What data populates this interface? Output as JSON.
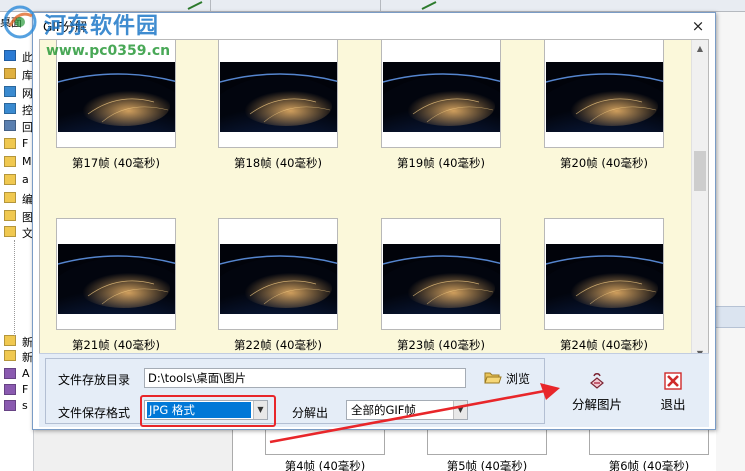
{
  "background": {
    "left_panel": {
      "title": "桌面",
      "items": [
        {
          "label": "此",
          "icon": "monitor-icon",
          "color": "#2b7bd4"
        },
        {
          "label": "库",
          "icon": "library-icon",
          "color": "#e0b040"
        },
        {
          "label": "网",
          "icon": "network-icon",
          "color": "#3a8ad0"
        },
        {
          "label": "控",
          "icon": "control-panel-icon",
          "color": "#3a8ad0"
        },
        {
          "label": "回",
          "icon": "recycle-bin-icon",
          "color": "#5a7fb0"
        },
        {
          "label": "F",
          "icon": "folder-icon",
          "color": "#f0c850"
        },
        {
          "label": "M",
          "icon": "folder-icon",
          "color": "#f0c850"
        },
        {
          "label": "a",
          "icon": "folder-icon",
          "color": "#f0c850"
        },
        {
          "label": "编",
          "icon": "folder-icon",
          "color": "#f0c850"
        },
        {
          "label": "图",
          "icon": "folder-icon",
          "color": "#f0c850"
        },
        {
          "label": "文",
          "icon": "folder-icon",
          "color": "#f0c850"
        }
      ],
      "bottom_items": [
        {
          "label": "新",
          "icon": "folder-icon",
          "color": "#f0c850"
        },
        {
          "label": "新",
          "icon": "folder-icon",
          "color": "#f0c850"
        },
        {
          "label": "A",
          "icon": "archive-icon",
          "color": "#8a5ab0"
        },
        {
          "label": "F",
          "icon": "archive-icon",
          "color": "#8a5ab0"
        },
        {
          "label": "s",
          "icon": "archive-icon",
          "color": "#8a5ab0"
        }
      ]
    },
    "bottom_frames": [
      {
        "caption": "第4帧 (40毫秒)"
      },
      {
        "caption": "第5帧 (40毫秒)"
      },
      {
        "caption": "第6帧 (40毫秒)"
      }
    ]
  },
  "watermark": {
    "name": "河东软件园",
    "url": "www.pc0359.cn"
  },
  "dialog": {
    "title": "GIF分解",
    "close_icon": "×",
    "frames": [
      {
        "caption": "第17帧 (40毫秒)"
      },
      {
        "caption": "第18帧 (40毫秒)"
      },
      {
        "caption": "第19帧 (40毫秒)"
      },
      {
        "caption": "第20帧 (40毫秒)"
      },
      {
        "caption": "第21帧 (40毫秒)"
      },
      {
        "caption": "第22帧 (40毫秒)"
      },
      {
        "caption": "第23帧 (40毫秒)"
      },
      {
        "caption": "第24帧 (40毫秒)"
      }
    ],
    "scroll_position": 0.38,
    "form": {
      "dir_label": "文件存放目录",
      "dir_value": "D:\\tools\\桌面\\图片",
      "browse_label": "浏览",
      "format_label": "文件保存格式",
      "format_value": "JPG 格式",
      "split_label": "分解出",
      "split_value": "全部的GIF帧"
    },
    "buttons": {
      "split": "分解图片",
      "exit": "退出"
    },
    "colors": {
      "grid_bg": "#fbf8da",
      "panel_bg": "#e5edf7",
      "selection": "#0078d7",
      "highlight": "#e8262a"
    }
  }
}
